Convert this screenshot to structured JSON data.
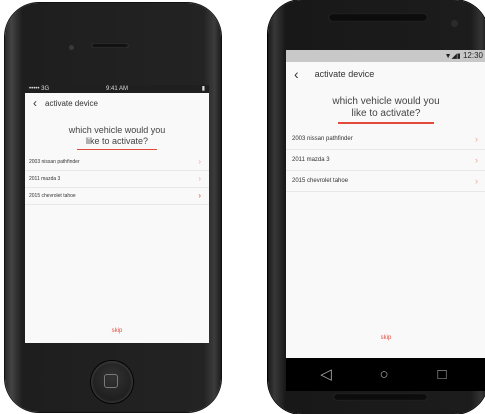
{
  "iphone": {
    "status": {
      "carrier": "••••• 3G",
      "time": "9:41 AM",
      "battery": "1 ▬"
    },
    "app": {
      "title": "activate device",
      "question_line1": "which vehicle would you",
      "question_line2": "like to activate?",
      "vehicles": [
        "2003 nissan pathfinder",
        "2011 mazda 3",
        "2015 chevrolet tahoe"
      ],
      "skip": "skip"
    }
  },
  "android": {
    "status": {
      "icons": "▼◢▮",
      "time": "12:30"
    },
    "app": {
      "title": "activate device",
      "question_line1": "which vehicle would you",
      "question_line2": "like to activate?",
      "vehicles": [
        "2003 nissan pathfinder",
        "2011 mazda 3",
        "2015 chevrolet tahoe"
      ],
      "skip": "skip"
    }
  },
  "colors": {
    "accent": "#e24b3b",
    "chevron": "#f1a39c"
  },
  "icons": {
    "back": "chevron-left-icon",
    "row": "chevron-right-icon"
  }
}
